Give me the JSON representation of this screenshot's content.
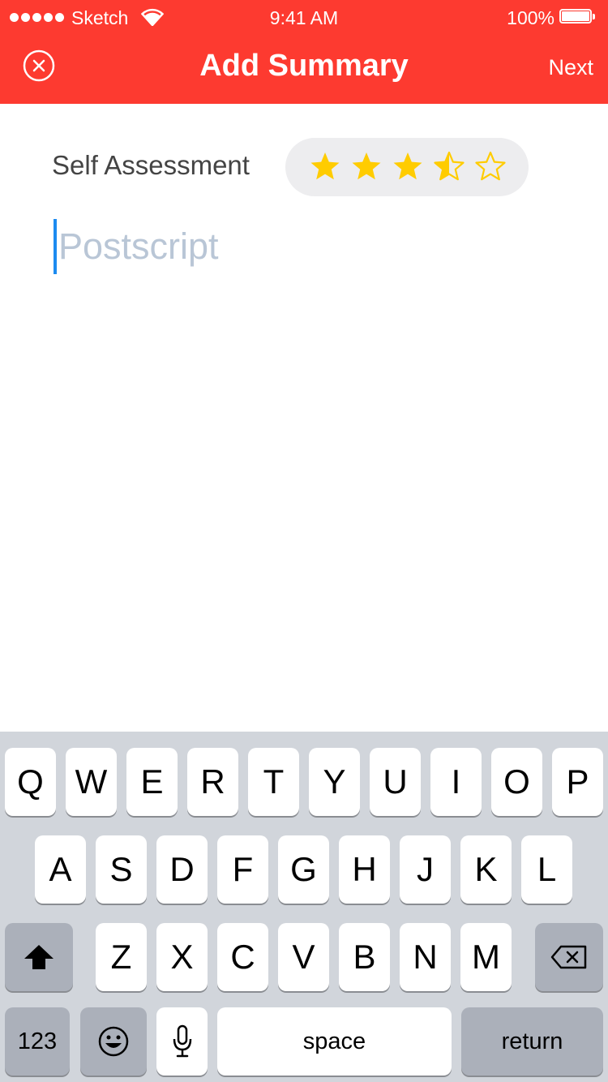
{
  "status_bar": {
    "carrier": "Sketch",
    "time": "9:41 AM",
    "battery": "100%"
  },
  "nav": {
    "title": "Add Summary",
    "close_icon": "close-circle-icon",
    "next_label": "Next"
  },
  "assessment": {
    "label": "Self Assessment",
    "rating": 3.5,
    "max_rating": 5,
    "star_color": "#ffcc00"
  },
  "postscript": {
    "placeholder": "Postscript",
    "value": ""
  },
  "keyboard": {
    "row1": [
      "Q",
      "W",
      "E",
      "R",
      "T",
      "Y",
      "U",
      "I",
      "O",
      "P"
    ],
    "row2": [
      "A",
      "S",
      "D",
      "F",
      "G",
      "H",
      "J",
      "K",
      "L"
    ],
    "row3": [
      "Z",
      "X",
      "C",
      "V",
      "B",
      "N",
      "M"
    ],
    "shift_icon": "shift-icon",
    "delete_icon": "delete-icon",
    "numbers_label": "123",
    "emoji_icon": "emoji-icon",
    "mic_icon": "microphone-icon",
    "space_label": "space",
    "return_label": "return"
  },
  "colors": {
    "header": "#fd3a30",
    "keyboard_bg": "#d1d5db",
    "cursor": "#1c8bf0",
    "placeholder": "#b9c6d6"
  }
}
